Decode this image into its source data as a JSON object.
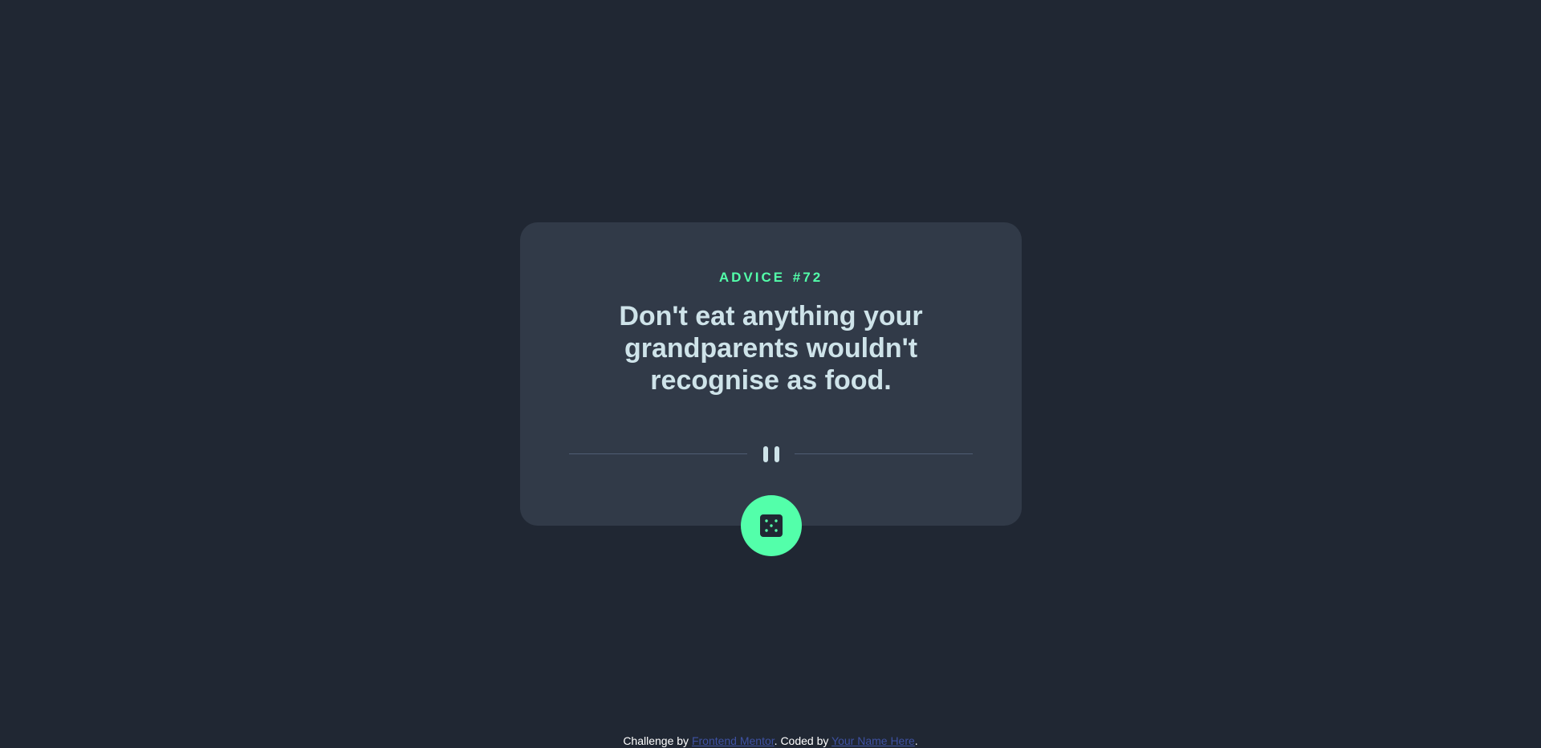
{
  "card": {
    "advice_label": "ADVICE",
    "advice_number": "#72",
    "quote": "Don't eat anything your grandparents wouldn't recognise as food.",
    "divider_icon": "pause-icon",
    "dice_button_icon": "dice-icon"
  },
  "attribution": {
    "prefix": "Challenge by",
    "challenge_link": "Frontend Mentor",
    "middle": ". Coded by",
    "author_link": "Your Name Here",
    "suffix": "."
  },
  "colors": {
    "background": "#202733",
    "card": "#313a48",
    "accent": "#53ffaa",
    "text": "#cee3e9",
    "divider": "#4f5d74",
    "link": "#3e52a3"
  }
}
